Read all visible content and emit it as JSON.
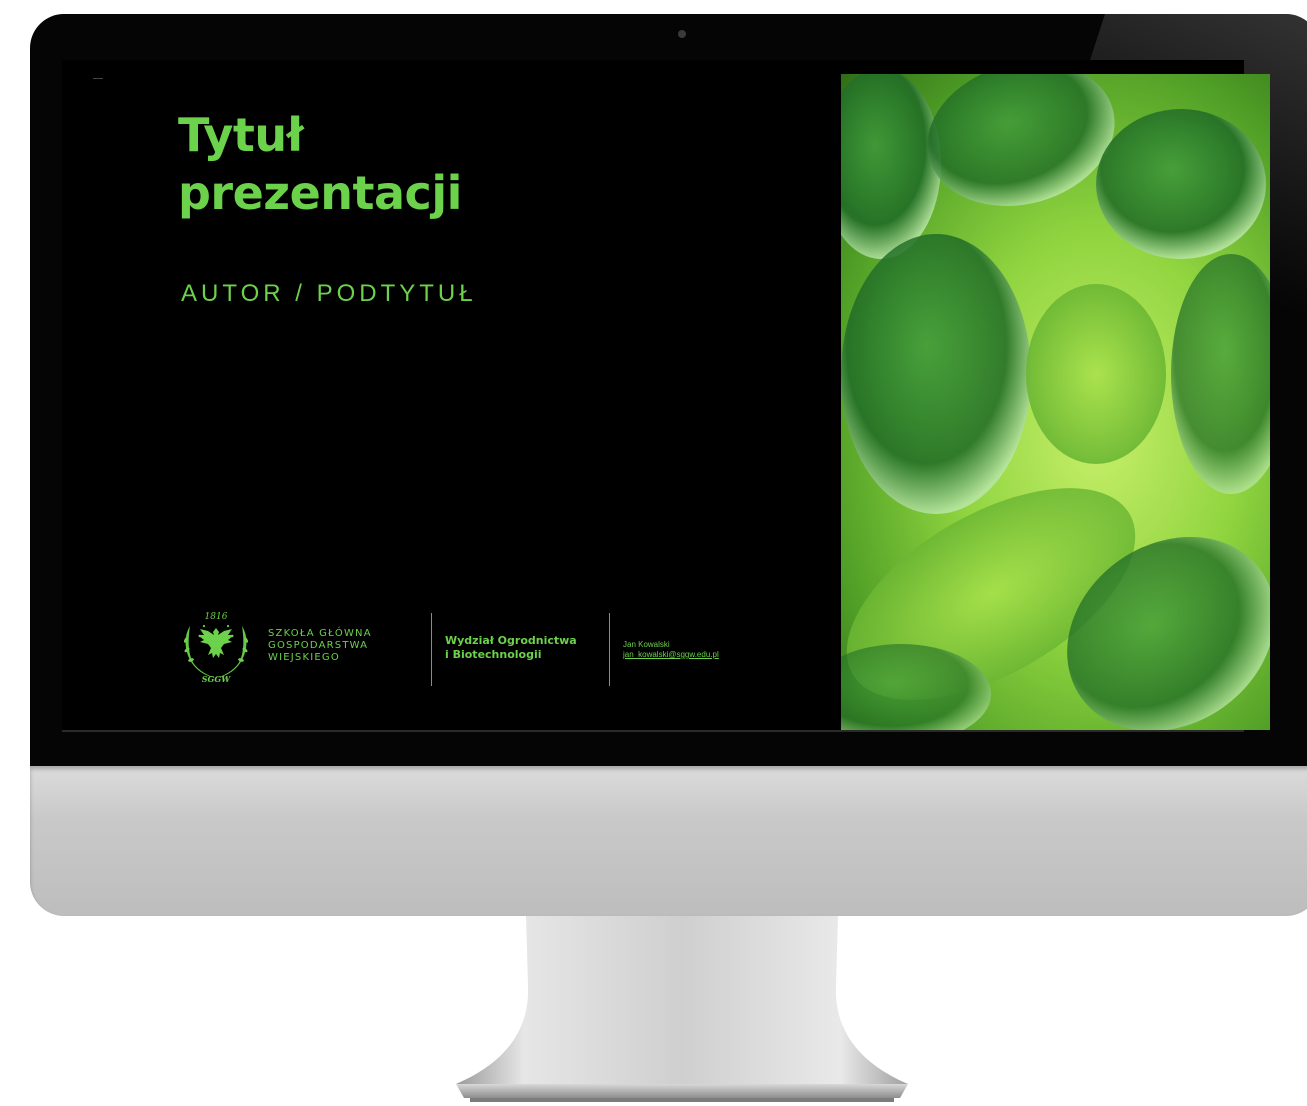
{
  "slide": {
    "title_line1": "Tytuł",
    "title_line2": "prezentacji",
    "subtitle": "AUTOR / PODTYTUŁ",
    "crest_year": "1816",
    "crest_letters": "SGGW",
    "university": [
      "SZKOŁA GŁÓWNA",
      "GOSPODARSTWA",
      "WIEJSKIEGO"
    ],
    "department": [
      "Wydział Ogrodnictwa",
      "i Biotechnologii"
    ],
    "contact_name": "Jan Kowalski",
    "contact_email": "jan_kowalski@sggw.edu.pl"
  },
  "colors": {
    "accent": "#6cd14b",
    "background": "#000000",
    "bezel": "#050505",
    "chin": "#c9c9c9"
  },
  "icons": {
    "crest": "sggw-crest-icon",
    "photo": "green-plant-macro-photo"
  }
}
